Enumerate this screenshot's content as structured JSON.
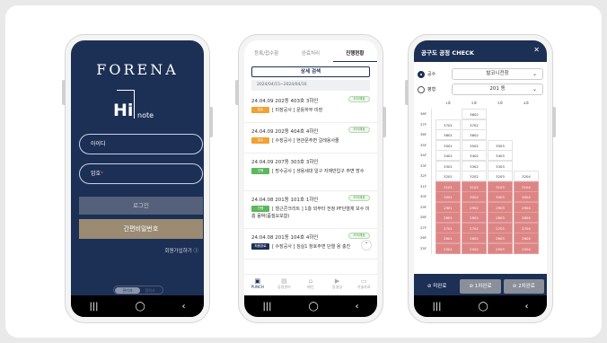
{
  "phone1": {
    "brand": "FORENA",
    "logo_hi": "Hi",
    "logo_note": "note",
    "id_label": "아이디",
    "pw_label": "암호",
    "pw_required": "*",
    "login_button": "로그인",
    "simple_pw_button": "간편비밀번호",
    "signup_link": "회원가입하기 ⓘ",
    "toggle_on": "관리자",
    "toggle_off": "협력사",
    "nav": [
      "|||",
      "◯",
      "‹"
    ]
  },
  "phone2": {
    "tabs": [
      "등록/접수함",
      "완료처리",
      "진행현황"
    ],
    "search_button": "상세 검색",
    "date_range": "2024/04/15~2024/04/16",
    "items": [
      {
        "header": "24.04.09 202동 403호 3하인",
        "status": "조치예정",
        "tag": "접수",
        "tag_color": "#f0a234",
        "text": "[ 미장공사 ] 문틀하부 미장"
      },
      {
        "header": "24.04.09 202동 404호 4하인",
        "status": "조치예정",
        "tag": "접수",
        "tag_color": "#f0a234",
        "text": "[ 수장공사 ] 현관문주변 걸레용사줄"
      },
      {
        "header": "24.04.09 207동 303호 3하인",
        "status": "",
        "tag": "진행",
        "tag_color": "#5bb85d",
        "text": "[ 방수공사 ] 생용세대 일구 자재반입구 주변 방수"
      },
      {
        "header": "24.04.08 201동 101호 1하인",
        "status": "조치예정",
        "tag": "진행",
        "tag_color": "#5bb85d",
        "text": "[ 철근콘크리트 ] 1층 외부타 전정 PF단열재 보수 미흡 음박(품질요보함)"
      },
      {
        "header": "24.04.08 201동 104호 4하인",
        "status": "조치예정",
        "tag": "최종완료",
        "tag_color": "#1c2f55",
        "text": "[ 수장공사 ] 침실1 창호주변 단열 용 충진"
      }
    ],
    "bottom_tabs": [
      {
        "icon": "▣",
        "label": "PUNCH"
      },
      {
        "icon": "▤",
        "label": "공정관리"
      },
      {
        "icon": "⌂",
        "label": "메인"
      },
      {
        "icon": "▶",
        "label": "동영상"
      },
      {
        "icon": "▭",
        "label": "기술자료"
      }
    ],
    "fab": "⌃",
    "nav": [
      "|||",
      "◯",
      "‹"
    ]
  },
  "phone3": {
    "title": "공구도 공정 CHECK",
    "close": "✕",
    "select1_label": "공수",
    "select1_value": "발코니전창",
    "select2_label": "평형",
    "select2_value": "201 동",
    "col_heads": [
      "1호",
      "2호",
      "3호",
      "4호"
    ],
    "floors": [
      "36F",
      "37F",
      "36F",
      "35F",
      "34F",
      "33F",
      "32F",
      "31F",
      "30F",
      "29F",
      "28F",
      "27F",
      "26F",
      "25F"
    ],
    "buttons": [
      "⊘ 미완료",
      "⊘ 1차완료",
      "⊘ 2차완료"
    ],
    "nav": [
      "|||",
      "◯",
      "‹"
    ]
  }
}
